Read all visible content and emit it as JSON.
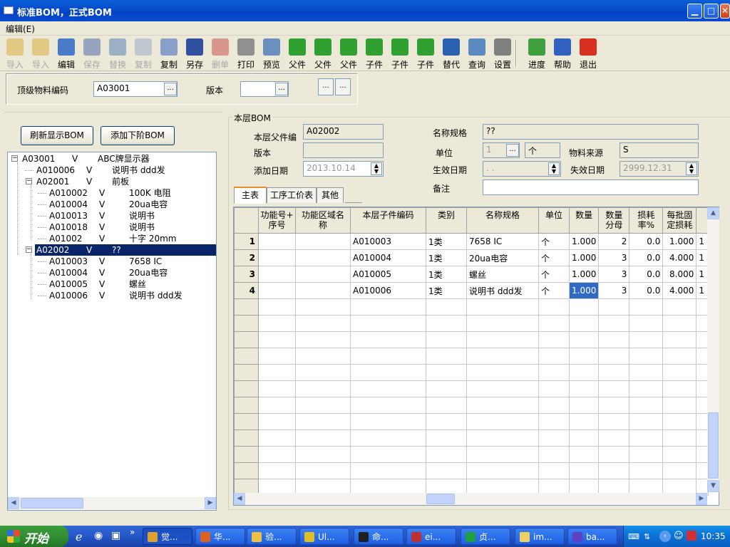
{
  "window": {
    "title": "标准BOM，正式BOM"
  },
  "menu": {
    "edit": "编辑(E)"
  },
  "toolbar": [
    {
      "label": "导入",
      "icon": "import-icon",
      "enabled": false,
      "color": "#d9a520"
    },
    {
      "label": "导入",
      "icon": "import-icon",
      "enabled": false,
      "color": "#d9a520"
    },
    {
      "label": "编辑",
      "icon": "edit-icon",
      "enabled": true,
      "color": "#4a7bc8"
    },
    {
      "label": "保存",
      "icon": "save-icon",
      "enabled": false,
      "color": "#3050a0"
    },
    {
      "label": "替换",
      "icon": "replace-icon",
      "enabled": false,
      "color": "#3a6ab0"
    },
    {
      "label": "复制",
      "icon": "copy-icon",
      "enabled": false,
      "color": "#8aa0c8"
    },
    {
      "label": "复制",
      "icon": "copy-icon",
      "enabled": true,
      "color": "#8aa0c8"
    },
    {
      "label": "另存",
      "icon": "save-as-icon",
      "enabled": true,
      "color": "#3050a0"
    },
    {
      "label": "删单",
      "icon": "delete-icon",
      "enabled": false,
      "color": "#c03030"
    },
    {
      "label": "打印",
      "icon": "print-icon",
      "enabled": true,
      "color": "#909090"
    },
    {
      "label": "预览",
      "icon": "preview-icon",
      "enabled": true,
      "color": "#6a90c0"
    },
    {
      "label": "父件",
      "icon": "parent-icon",
      "enabled": true,
      "color": "#30a030"
    },
    {
      "label": "父件",
      "icon": "parent-icon",
      "enabled": true,
      "color": "#30a030"
    },
    {
      "label": "父件",
      "icon": "parent-icon",
      "enabled": true,
      "color": "#30a030"
    },
    {
      "label": "子件",
      "icon": "child-icon",
      "enabled": true,
      "color": "#30a030"
    },
    {
      "label": "子件",
      "icon": "child-icon",
      "enabled": true,
      "color": "#30a030"
    },
    {
      "label": "子件",
      "icon": "child-icon",
      "enabled": true,
      "color": "#30a030"
    },
    {
      "label": "替代",
      "icon": "substitute-icon",
      "enabled": true,
      "color": "#2a60b0"
    },
    {
      "label": "查询",
      "icon": "search-icon",
      "enabled": true,
      "color": "#5a8ac0"
    },
    {
      "label": "设置",
      "icon": "settings-icon",
      "enabled": true,
      "color": "#808080"
    },
    {
      "label": "进度",
      "icon": "progress-icon",
      "enabled": true,
      "color": "#40a040"
    },
    {
      "label": "帮助",
      "icon": "help-icon",
      "enabled": true,
      "color": "#3060c0"
    },
    {
      "label": "退出",
      "icon": "exit-icon",
      "enabled": true,
      "color": "#d83020"
    }
  ],
  "top": {
    "top_code_label": "顶级物料编码",
    "top_code_value": "A03001",
    "version_label": "版本",
    "version_value": ""
  },
  "left": {
    "refresh_btn": "刷新显示BOM",
    "add_child_btn": "添加下阶BOM"
  },
  "tree": [
    {
      "code": "A03001",
      "v": "V",
      "name": "ABC牌显示器",
      "level": 0,
      "box": "-"
    },
    {
      "code": "A010006",
      "v": "V",
      "name": "说明书 ddd发",
      "level": 1
    },
    {
      "code": "A02001",
      "v": "V",
      "name": "前板",
      "level": 1,
      "box": "-"
    },
    {
      "code": "A010002",
      "v": "V",
      "name": "100K 电阻",
      "level": 2
    },
    {
      "code": "A010004",
      "v": "V",
      "name": "20ua电容",
      "level": 2
    },
    {
      "code": "A010013",
      "v": "V",
      "name": "说明书",
      "level": 2
    },
    {
      "code": "A010018",
      "v": "V",
      "name": "说明书",
      "level": 2
    },
    {
      "code": "A01002",
      "v": "V",
      "name": "十字 20mm",
      "level": 2
    },
    {
      "code": "A02002",
      "v": "V",
      "name": "??",
      "level": 1,
      "box": "-",
      "selected": true
    },
    {
      "code": "A010003",
      "v": "V",
      "name": "7658 IC",
      "level": 2
    },
    {
      "code": "A010004",
      "v": "V",
      "name": "20ua电容",
      "level": 2
    },
    {
      "code": "A010005",
      "v": "V",
      "name": "螺丝",
      "level": 2
    },
    {
      "code": "A010006",
      "v": "V",
      "name": "说明书 ddd发",
      "level": 2
    }
  ],
  "bom": {
    "group_title": "本层BOM",
    "parent_code_label": "本层父件编",
    "parent_code": "A02002",
    "name_spec_label": "名称规格",
    "name_spec": "??",
    "version_label": "版本",
    "version": "",
    "unit_label": "单位",
    "unit_num": "1",
    "unit_name": "个",
    "source_label": "物料来源",
    "source": "S",
    "add_date_label": "添加日期",
    "add_date": "2013.10.14",
    "eff_date_label": "生效日期",
    "eff_date": ". .",
    "exp_date_label": "失效日期",
    "exp_date": "2999.12.31",
    "remark_label": "备注",
    "remark": ""
  },
  "tabs": [
    "主表",
    "工序工价表",
    "其他"
  ],
  "grid": {
    "columns": [
      "功能号+\n序号",
      "功能区域名\n称",
      "本层子件编码",
      "类别",
      "名称规格",
      "单位",
      "数量",
      "数量\n分母",
      "损耗\n率%",
      "每批固\n定损耗",
      ""
    ],
    "rows": [
      {
        "n": "1",
        "c": [
          "",
          "",
          "A010003",
          "1类",
          "7658 IC",
          "个",
          "1.000",
          "2",
          "0.0",
          "1.000",
          "1"
        ]
      },
      {
        "n": "2",
        "c": [
          "",
          "",
          "A010004",
          "1类",
          "20ua电容",
          "个",
          "1.000",
          "3",
          "0.0",
          "4.000",
          "1"
        ]
      },
      {
        "n": "3",
        "c": [
          "",
          "",
          "A010005",
          "1类",
          "螺丝",
          "个",
          "1.000",
          "3",
          "0.0",
          "8.000",
          "1"
        ]
      },
      {
        "n": "4",
        "c": [
          "",
          "",
          "A010006",
          "1类",
          "说明书 ddd发",
          "个",
          "1.000",
          "3",
          "0.0",
          "4.000",
          "1"
        ]
      }
    ]
  },
  "taskbar": {
    "start": "开始",
    "tasks": [
      {
        "label": "觉...",
        "color": "#e0a030",
        "active": true
      },
      {
        "label": "华...",
        "color": "#e06020"
      },
      {
        "label": "验...",
        "color": "#f0c040"
      },
      {
        "label": "Ul...",
        "color": "#e0c020"
      },
      {
        "label": "命...",
        "color": "#202020"
      },
      {
        "label": "ei...",
        "color": "#c03030"
      },
      {
        "label": "贞...",
        "color": "#20a040"
      },
      {
        "label": "im...",
        "color": "#f0d060"
      },
      {
        "label": "ba...",
        "color": "#6040c0"
      }
    ],
    "clock": "10:35"
  }
}
